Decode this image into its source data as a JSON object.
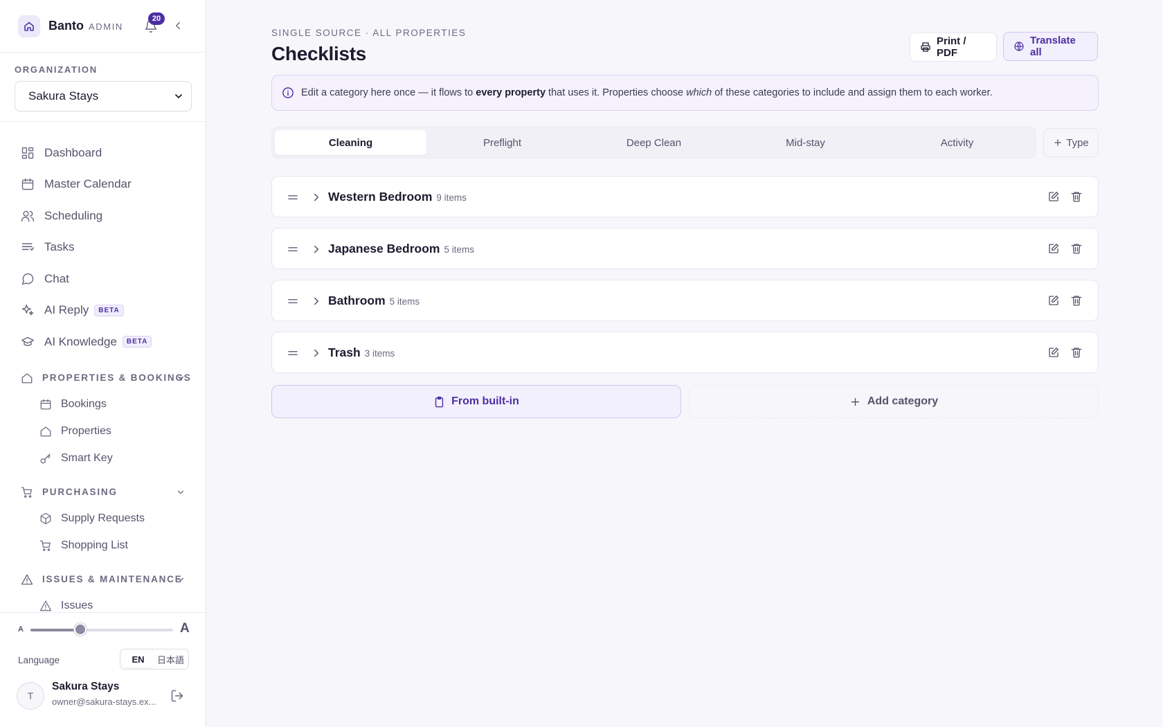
{
  "sidebar": {
    "brand": {
      "name": "Banto",
      "role": "ADMIN"
    },
    "notifications": {
      "count": "20"
    },
    "organization": {
      "label": "ORGANIZATION",
      "selected": "Sakura Stays"
    },
    "nav": [
      {
        "label": "Dashboard",
        "icon": "dashboard-icon"
      },
      {
        "label": "Master Calendar",
        "icon": "calendar-icon"
      },
      {
        "label": "Scheduling",
        "icon": "users-icon"
      },
      {
        "label": "Tasks",
        "icon": "list-icon"
      },
      {
        "label": "Chat",
        "icon": "chat-icon"
      },
      {
        "label": "AI Reply",
        "icon": "sparkle-icon",
        "badge": "BETA"
      },
      {
        "label": "AI Knowledge",
        "icon": "graduation-cap-icon",
        "badge": "BETA"
      }
    ],
    "sections": [
      {
        "label": "PROPERTIES & BOOKINGS",
        "items": [
          "Bookings",
          "Properties",
          "Smart Key"
        ]
      },
      {
        "label": "PURCHASING",
        "items": [
          "Supply Requests",
          "Shopping List"
        ]
      },
      {
        "label": "ISSUES & MAINTENANCE",
        "items": [
          "Issues"
        ]
      }
    ],
    "font_size": {
      "small_label": "A",
      "large_label": "A",
      "level": 0.35
    },
    "language": {
      "label": "Language",
      "options": [
        "EN",
        "日本語"
      ],
      "selected": "EN"
    },
    "user": {
      "initial": "T",
      "name": "Sakura Stays",
      "email": "owner@sakura-stays.ex..."
    }
  },
  "main": {
    "eyebrow": "SINGLE SOURCE · ALL PROPERTIES",
    "title": "Checklists",
    "buttons": {
      "print": "Print / PDF",
      "translate": "Translate all"
    },
    "banner": {
      "part1": "Edit a category here once — it flows to ",
      "bold": "every property",
      "part2": " that uses it. Properties choose ",
      "italic": "which",
      "part3": " of these categories to include and assign them to each worker."
    },
    "tabs": [
      "Cleaning",
      "Preflight",
      "Deep Clean",
      "Mid-stay",
      "Activity"
    ],
    "active_tab": "Cleaning",
    "add_type": "Type",
    "categories": [
      {
        "name": "Western Bedroom",
        "count": "9 items"
      },
      {
        "name": "Japanese Bedroom",
        "count": "5 items"
      },
      {
        "name": "Bathroom",
        "count": "5 items"
      },
      {
        "name": "Trash",
        "count": "3 items"
      }
    ],
    "from_builtin": "From built-in",
    "add_category": "Add category"
  },
  "colors": {
    "accent": "#4b2fa3",
    "accent_soft": "#f3f0fd",
    "background": "#f7f7fb"
  }
}
